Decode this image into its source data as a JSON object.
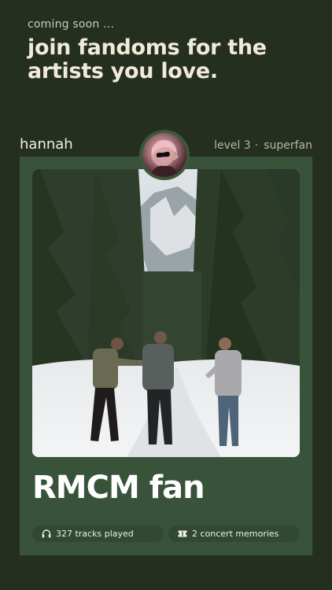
{
  "promo": {
    "eyebrow": "coming soon ...",
    "headline_line1": "join fandoms for the",
    "headline_line2": "artists you love."
  },
  "profile": {
    "username": "hannah",
    "level": "level 3",
    "rank": "superfan",
    "avatar_icon": "user-avatar-photo"
  },
  "card": {
    "background_color": "#39533a",
    "photo_description_icon": "band-photo",
    "fan_title": "RMCM fan",
    "stats": {
      "tracks_icon": "headphones-icon",
      "tracks_label": "327 tracks played",
      "concerts_icon": "ticket-icon",
      "concerts_label": "2 concert memories"
    }
  },
  "colors": {
    "page_background": "#242f20",
    "headline": "#f0ead8",
    "muted_text": "#b6b7a5"
  }
}
